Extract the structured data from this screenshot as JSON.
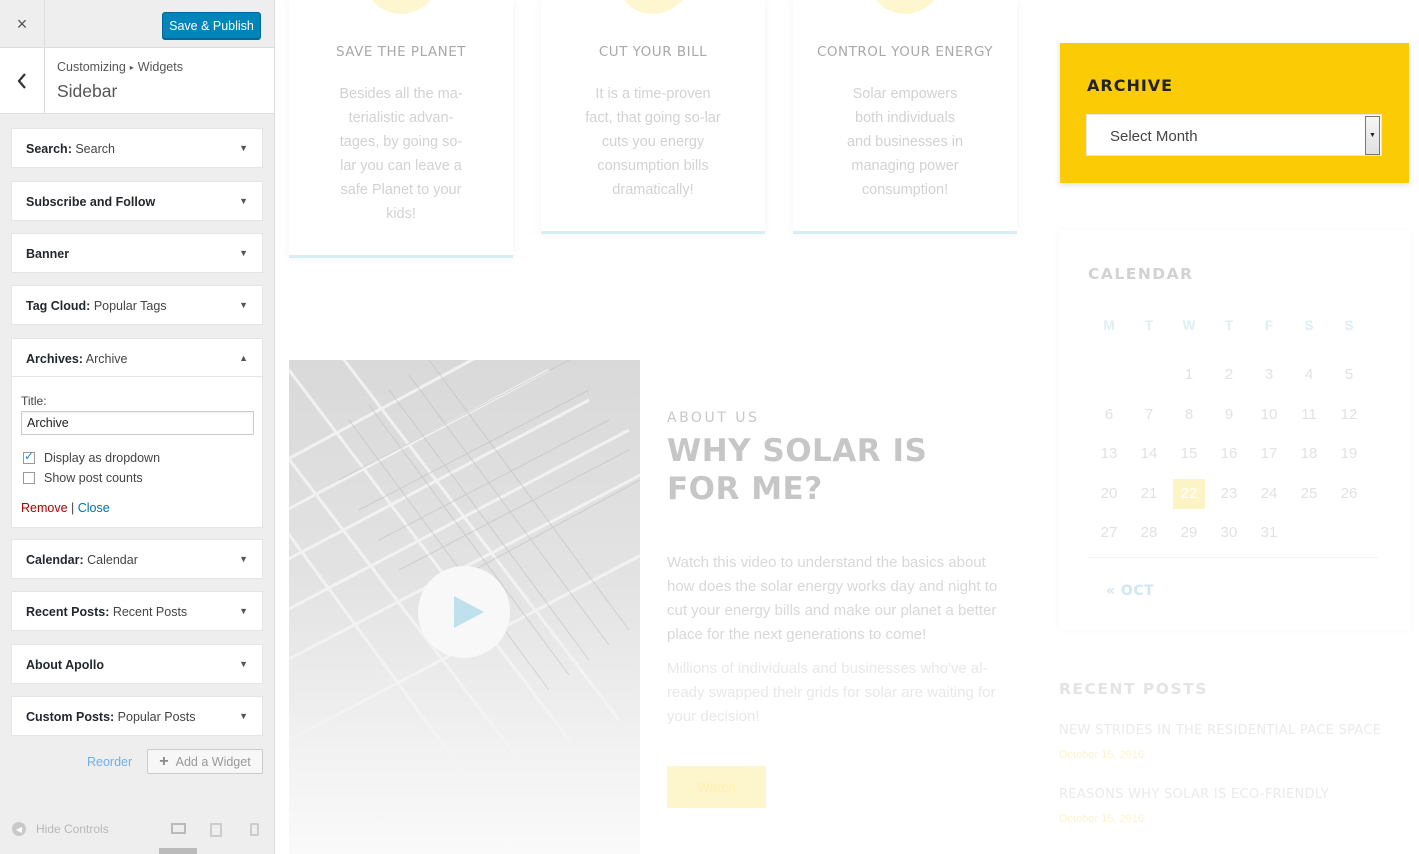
{
  "customizer": {
    "close_icon": "×",
    "publish_label": "Save & Publish",
    "back_icon": "‹",
    "breadcrumb": {
      "root": "Customizing",
      "sep": "▸",
      "current": "Widgets"
    },
    "section_title": "Sidebar",
    "widgets": [
      {
        "type": "Search:",
        "title": " Search"
      },
      {
        "type": "Subscribe and Follow",
        "title": ""
      },
      {
        "type": "Banner",
        "title": ""
      },
      {
        "type": "Tag Cloud:",
        "title": " Popular Tags"
      },
      {
        "type": "Archives:",
        "title": " Archive"
      },
      {
        "type": "Calendar:",
        "title": " Calendar"
      },
      {
        "type": "Recent Posts:",
        "title": " Recent Posts"
      },
      {
        "type": "About Apollo",
        "title": ""
      },
      {
        "type": "Custom Posts:",
        "title": " Popular Posts"
      }
    ],
    "open_widget": {
      "title_label": "Title:",
      "title_value": "Archive",
      "dropdown_label": "Display as dropdown",
      "dropdown_checked": true,
      "counts_label": "Show post counts",
      "counts_checked": false,
      "remove_label": "Remove",
      "link_sep": " | ",
      "close_label": "Close"
    },
    "reorder_label": "Reorder",
    "add_widget_label": "Add a Widget",
    "hide_controls_label": "Hide Controls"
  },
  "preview": {
    "features": [
      {
        "title": "SAVE THE PLANET",
        "text": "Besides all the ma-terialistic advan-tages, by going so-lar you can leave a safe Planet to your kids!"
      },
      {
        "title": "CUT YOUR BILL",
        "text": "It is a time-proven fact, that going so-lar cuts you energy consumption bills dramatically!"
      },
      {
        "title": "CONTROL YOUR ENERGY",
        "text": "Solar empowers both individuals and businesses in managing power consumption!"
      }
    ],
    "about": {
      "label": "ABOUT US",
      "title": "WHY SOLAR IS FOR ME?",
      "p1": "Watch this video to understand the basics about how does the solar energy works day and night to cut your energy bills and make our planet a better place for the next generations to come!",
      "p2": "Millions of individuals and businesses who've al-ready swapped their grids for solar are waiting for your decision!",
      "watch_label": "Watch"
    },
    "archive_widget": {
      "title": "ARCHIVE",
      "select_value": "Select Month"
    },
    "calendar": {
      "title": "CALENDAR",
      "dow": [
        "M",
        "T",
        "W",
        "T",
        "F",
        "S",
        "S"
      ],
      "weeks": [
        [
          "",
          "",
          "1",
          "2",
          "3",
          "4",
          "5"
        ],
        [
          "6",
          "7",
          "8",
          "9",
          "10",
          "11",
          "12"
        ],
        [
          "13",
          "14",
          "15",
          "16",
          "17",
          "18",
          "19"
        ],
        [
          "20",
          "21",
          "22",
          "23",
          "24",
          "25",
          "26"
        ],
        [
          "27",
          "28",
          "29",
          "30",
          "31",
          "",
          ""
        ]
      ],
      "today": "22",
      "prev_link": "« OCT"
    },
    "recent_posts": {
      "title": "RECENT POSTS",
      "items": [
        {
          "title": "NEW STRIDES IN THE RESIDENTIAL PACE SPACE",
          "date": "October 15, 2016"
        },
        {
          "title": "REASONS WHY SOLAR IS ECO-FRIENDLY",
          "date": "October 15, 2016"
        }
      ]
    }
  }
}
